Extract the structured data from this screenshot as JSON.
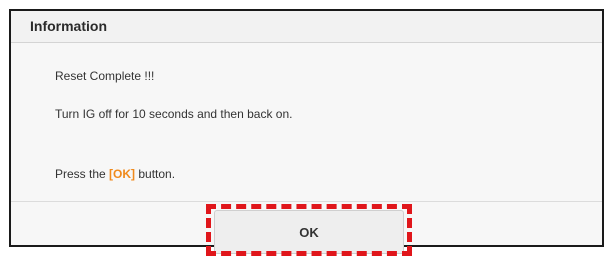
{
  "dialog": {
    "title": "Information",
    "line1": "Reset Complete !!!",
    "line2": "Turn IG off for 10 seconds and then back on.",
    "line3_prefix": "Press the ",
    "line3_highlight": "[OK]",
    "line3_suffix": " button."
  },
  "buttons": {
    "ok_label": "OK"
  },
  "colors": {
    "highlight": "#f08a1c",
    "annotation": "#e0161b"
  }
}
